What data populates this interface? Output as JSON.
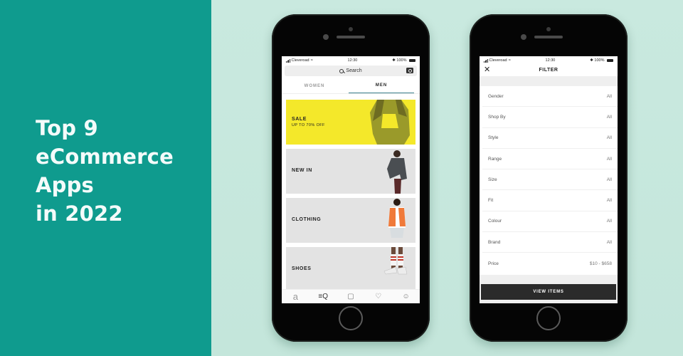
{
  "headline": {
    "lines": [
      "Top 9",
      "eCommerce",
      "Apps",
      "in 2022"
    ]
  },
  "colors": {
    "panel": "#0f9b8e",
    "background": "#c7e8de",
    "sale_banner": "#f4e82a",
    "tab_underline": "#3a7f8c"
  },
  "left_phone": {
    "status": {
      "carrier": "Cleveroad",
      "time": "12:30",
      "battery": "100%"
    },
    "search": {
      "placeholder": "Search"
    },
    "tabs": [
      {
        "label": "WOMEN",
        "active": false
      },
      {
        "label": "MEN",
        "active": true
      }
    ],
    "banners": [
      {
        "title": "SALE",
        "subtitle": "UP TO 70% OFF"
      },
      {
        "title": "NEW IN"
      },
      {
        "title": "CLOTHING"
      },
      {
        "title": "SHOES"
      }
    ],
    "tabbar": [
      {
        "icon": "home-logo-icon",
        "glyph": "a"
      },
      {
        "icon": "search-menu-icon",
        "glyph": "≡Q"
      },
      {
        "icon": "bag-icon",
        "glyph": "▢"
      },
      {
        "icon": "heart-icon",
        "glyph": "♡"
      },
      {
        "icon": "account-icon",
        "glyph": "☺"
      }
    ]
  },
  "right_phone": {
    "status": {
      "carrier": "Cleveroad",
      "time": "12:30",
      "battery": "100%"
    },
    "title": "FILTER",
    "close_glyph": "✕",
    "filters": [
      {
        "label": "Gender",
        "value": "All"
      },
      {
        "label": "Shop By",
        "value": "All"
      },
      {
        "label": "Style",
        "value": "All"
      },
      {
        "label": "Range",
        "value": "All"
      },
      {
        "label": "Size",
        "value": "All"
      },
      {
        "label": "Fit",
        "value": "All"
      },
      {
        "label": "Colour",
        "value": "All"
      },
      {
        "label": "Brand",
        "value": "All"
      },
      {
        "label": "Price",
        "value": "$10 - $658"
      }
    ],
    "button_label": "VIEW ITEMS"
  }
}
